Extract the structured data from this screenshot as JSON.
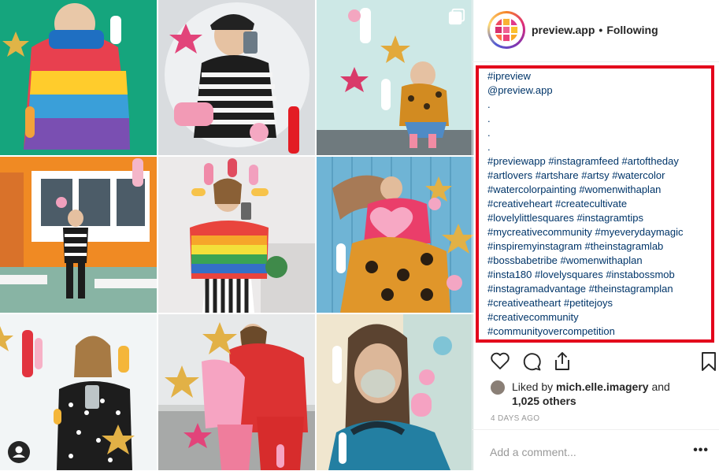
{
  "post": {
    "username": "preview.app",
    "separator": "•",
    "follow_status": "Following",
    "caption_lines": [
      "#ipreview",
      "@preview.app",
      ".",
      ".",
      ".",
      ".",
      "#previewapp #instagramfeed #artoftheday",
      "#artlovers #artshare #artsy #watercolor",
      "#watercolorpainting #womenwithaplan",
      "#creativeheart #createcultivate",
      "#lovelylittlesquares #instagramtips",
      "#mycreativecommunity #myeverydaymagic",
      "#inspiremyinstagram #theinstagramlab",
      "#bossbabetribe #womenwithaplan",
      "#insta180 #lovelysquares #instabossmob",
      "#instagramadvantage #theinstagramplan",
      "#creativeatheart #petitejoys",
      "#creativecommunity",
      "#communityovercompetition"
    ],
    "liked_by_prefix": "Liked by",
    "liked_by_user": "mich.elle.imagery",
    "liked_by_and": "and",
    "likes_count": "1,025 others",
    "timestamp": "4 DAYS AGO",
    "comment_placeholder": "Add a comment...",
    "more_options": "•••"
  },
  "icons": {
    "like": "heart-icon",
    "comment": "comment-icon",
    "share": "share-icon",
    "save": "bookmark-icon",
    "carousel": "multiple-photos-icon",
    "tagged": "user-tag-icon"
  },
  "colors": {
    "highlight_border": "#e3001b",
    "hashtag_link": "#003569",
    "muted_text": "#999999"
  }
}
